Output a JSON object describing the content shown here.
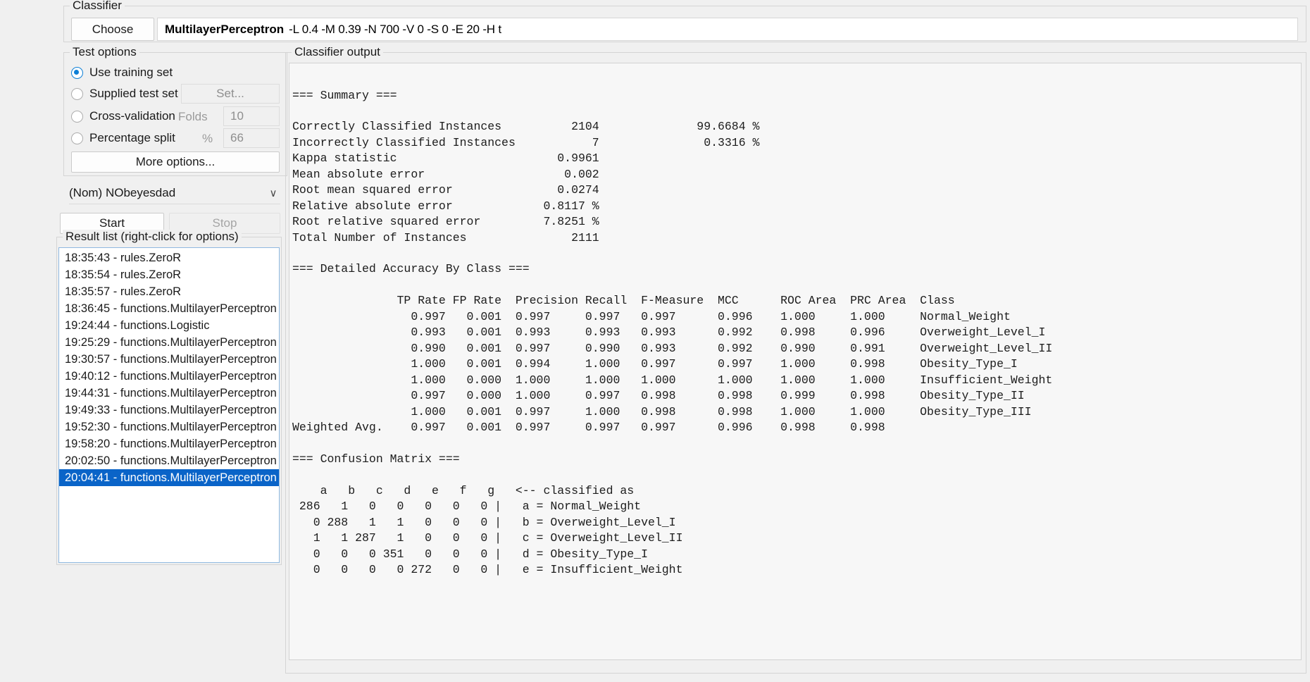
{
  "classifier": {
    "group_title": "Classifier",
    "choose_label": "Choose",
    "name": "MultilayerPerceptron",
    "options": "-L 0.4 -M 0.39 -N 700 -V 0 -S 0 -E 20 -H t"
  },
  "test_options": {
    "group_title": "Test options",
    "use_training_set": "Use training set",
    "supplied_test_set": "Supplied test set",
    "set_button": "Set...",
    "cross_validation": "Cross-validation",
    "folds_label": "Folds",
    "folds_value": "10",
    "percentage_split": "Percentage split",
    "percent_label": "%",
    "percent_value": "66",
    "more_options": "More options...",
    "selected": "use_training_set"
  },
  "class_selector": {
    "value": "(Nom) NObeyesdad",
    "chevron": "∨"
  },
  "run_controls": {
    "start_label": "Start",
    "stop_label": "Stop"
  },
  "result_list": {
    "group_title": "Result list (right-click for options)",
    "items": [
      "18:35:43 - rules.ZeroR",
      "18:35:54 - rules.ZeroR",
      "18:35:57 - rules.ZeroR",
      "18:36:45 - functions.MultilayerPerceptron",
      "19:24:44 - functions.Logistic",
      "19:25:29 - functions.MultilayerPerceptron",
      "19:30:57 - functions.MultilayerPerceptron",
      "19:40:12 - functions.MultilayerPerceptron",
      "19:44:31 - functions.MultilayerPerceptron",
      "19:49:33 - functions.MultilayerPerceptron",
      "19:52:30 - functions.MultilayerPerceptron",
      "19:58:20 - functions.MultilayerPerceptron",
      "20:02:50 - functions.MultilayerPerceptron",
      "20:04:41 - functions.MultilayerPerceptron"
    ],
    "selected_index": 13
  },
  "output": {
    "group_title": "Classifier output",
    "summary_heading": "=== Summary ===",
    "summary_rows": [
      {
        "label": "Correctly Classified Instances",
        "value": "2104",
        "pct": "99.6684 %"
      },
      {
        "label": "Incorrectly Classified Instances",
        "value": "7",
        "pct": "0.3316 %"
      },
      {
        "label": "Kappa statistic",
        "value": "0.9961",
        "pct": ""
      },
      {
        "label": "Mean absolute error",
        "value": "0.002",
        "pct": ""
      },
      {
        "label": "Root mean squared error",
        "value": "0.0274",
        "pct": ""
      },
      {
        "label": "Relative absolute error",
        "value": "0.8117 %",
        "pct": ""
      },
      {
        "label": "Root relative squared error",
        "value": "7.8251 %",
        "pct": ""
      },
      {
        "label": "Total Number of Instances",
        "value": "2111",
        "pct": ""
      }
    ],
    "accuracy_heading": "=== Detailed Accuracy By Class ===",
    "accuracy_columns": [
      "TP Rate",
      "FP Rate",
      "Precision",
      "Recall",
      "F-Measure",
      "MCC",
      "ROC Area",
      "PRC Area",
      "Class"
    ],
    "accuracy_rows": [
      {
        "tp": "0.997",
        "fp": "0.001",
        "precision": "0.997",
        "recall": "0.997",
        "f": "0.997",
        "mcc": "0.996",
        "roc": "1.000",
        "prc": "1.000",
        "class": "Normal_Weight"
      },
      {
        "tp": "0.993",
        "fp": "0.001",
        "precision": "0.993",
        "recall": "0.993",
        "f": "0.993",
        "mcc": "0.992",
        "roc": "0.998",
        "prc": "0.996",
        "class": "Overweight_Level_I"
      },
      {
        "tp": "0.990",
        "fp": "0.001",
        "precision": "0.997",
        "recall": "0.990",
        "f": "0.993",
        "mcc": "0.992",
        "roc": "0.990",
        "prc": "0.991",
        "class": "Overweight_Level_II"
      },
      {
        "tp": "1.000",
        "fp": "0.001",
        "precision": "0.994",
        "recall": "1.000",
        "f": "0.997",
        "mcc": "0.997",
        "roc": "1.000",
        "prc": "0.998",
        "class": "Obesity_Type_I"
      },
      {
        "tp": "1.000",
        "fp": "0.000",
        "precision": "1.000",
        "recall": "1.000",
        "f": "1.000",
        "mcc": "1.000",
        "roc": "1.000",
        "prc": "1.000",
        "class": "Insufficient_Weight"
      },
      {
        "tp": "0.997",
        "fp": "0.000",
        "precision": "1.000",
        "recall": "0.997",
        "f": "0.998",
        "mcc": "0.998",
        "roc": "0.999",
        "prc": "0.998",
        "class": "Obesity_Type_II"
      },
      {
        "tp": "1.000",
        "fp": "0.001",
        "precision": "0.997",
        "recall": "1.000",
        "f": "0.998",
        "mcc": "0.998",
        "roc": "1.000",
        "prc": "1.000",
        "class": "Obesity_Type_III"
      }
    ],
    "weighted_avg_label": "Weighted Avg.",
    "weighted_avg": {
      "tp": "0.997",
      "fp": "0.001",
      "precision": "0.997",
      "recall": "0.997",
      "f": "0.997",
      "mcc": "0.996",
      "roc": "0.998",
      "prc": "0.998",
      "class": ""
    },
    "confusion_heading": "=== Confusion Matrix ===",
    "confusion_col_letters": [
      "a",
      "b",
      "c",
      "d",
      "e",
      "f",
      "g"
    ],
    "confusion_legend_header": "<-- classified as",
    "confusion_rows": [
      {
        "counts": [
          "286",
          "1",
          "0",
          "0",
          "0",
          "0",
          "0"
        ],
        "legend": "a = Normal_Weight"
      },
      {
        "counts": [
          "0",
          "288",
          "1",
          "1",
          "0",
          "0",
          "0"
        ],
        "legend": "b = Overweight_Level_I"
      },
      {
        "counts": [
          "1",
          "1",
          "287",
          "1",
          "0",
          "0",
          "0"
        ],
        "legend": "c = Overweight_Level_II"
      },
      {
        "counts": [
          "0",
          "0",
          "0",
          "351",
          "0",
          "0",
          "0"
        ],
        "legend": "d = Obesity_Type_I"
      },
      {
        "counts": [
          "0",
          "0",
          "0",
          "0",
          "272",
          "0",
          "0"
        ],
        "legend": "e = Insufficient_Weight"
      }
    ]
  },
  "colors": {
    "accent": "#0d7fd6",
    "selection": "#0a64c8",
    "window_bg": "#f0f0f0",
    "output_bg": "#f7f7f7"
  }
}
